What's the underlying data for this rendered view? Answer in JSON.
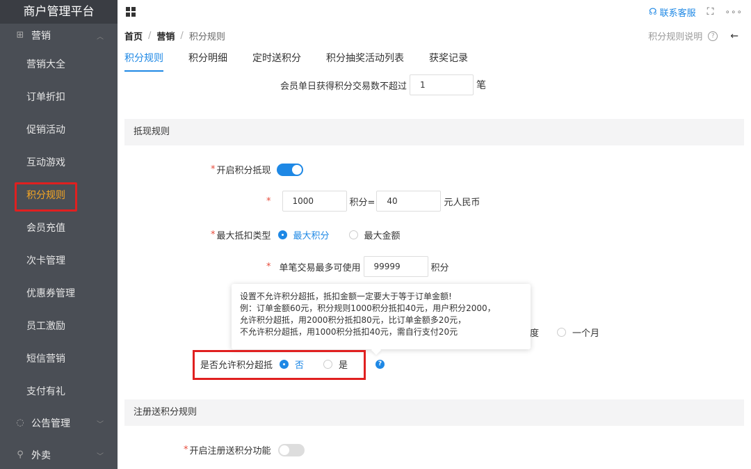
{
  "sidebar": {
    "brand": "商户管理平台",
    "groups": {
      "marketing": "营销",
      "notice": "公告管理",
      "takeout": "外卖"
    },
    "items": [
      "营销大全",
      "订单折扣",
      "促销活动",
      "互动游戏",
      "积分规则",
      "会员充值",
      "次卡管理",
      "优惠券管理",
      "员工激励",
      "短信营销",
      "支付有礼"
    ]
  },
  "topbar": {
    "support": "联系客服",
    "more": "∘∘∘"
  },
  "breadcrumb": {
    "home": "首页",
    "marketing": "营销",
    "current": "积分规则",
    "sep": "/"
  },
  "help": {
    "label": "积分规则说明",
    "q": "?"
  },
  "tabs": [
    "积分规则",
    "积分明细",
    "定时送积分",
    "积分抽奖活动列表",
    "获奖记录"
  ],
  "form": {
    "daily_limit_label": "会员单日获得积分交易数不超过",
    "daily_limit_value": "1",
    "daily_limit_unit": "笔",
    "section_cash": "抵现规则",
    "enable_cash_label": "开启积分抵现",
    "points_value": "1000",
    "points_eq": "积分=",
    "rmb_value": "40",
    "rmb_unit": "元人民币",
    "max_type_label": "最大抵扣类型",
    "max_points": "最大积分",
    "max_amount": "最大金额",
    "max_use_label": "单笔交易最多可使用",
    "max_use_value": "99999",
    "max_use_unit": "积分",
    "partial_text": "度",
    "one_month": "一个月",
    "overflow_label": "是否允许积分超抵",
    "no": "否",
    "yes": "是",
    "section_register": "注册送积分规则",
    "register_label": "开启注册送积分功能",
    "required_mark": "*"
  },
  "tooltip": {
    "line1": "设置不允许积分超抵，抵扣金额一定要大于等于订单金额!",
    "line2": "例：订单金额60元，积分规则1000积分抵扣40元，用户积分2000，",
    "line3": "允许积分超抵，用2000积分抵扣80元，比订单金额多20元，",
    "line4": "不允许积分超抵，用1000积分抵扣40元，需自行支付20元"
  },
  "colors": {
    "sidebar_bg": "#4a4e55",
    "accent": "#1e88e5",
    "active_item": "#f5a623",
    "highlight": "#e02020"
  }
}
